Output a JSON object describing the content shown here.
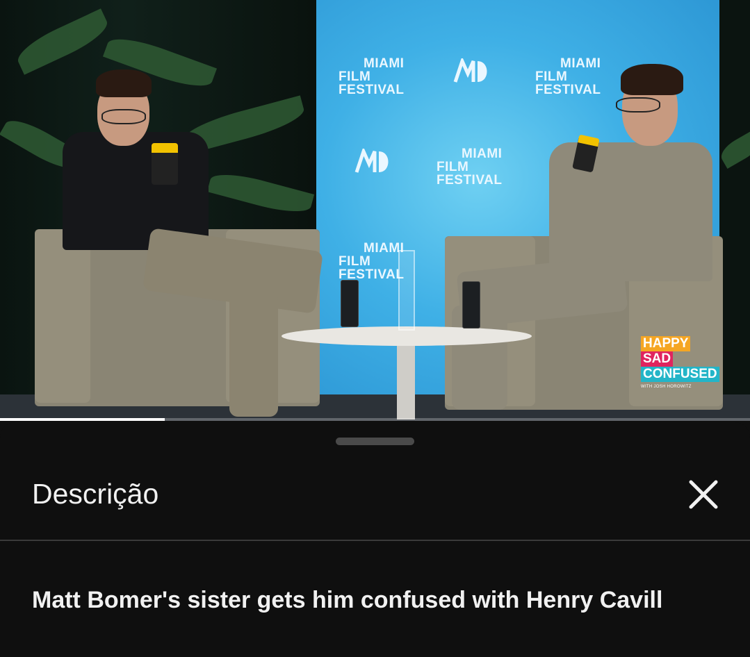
{
  "video": {
    "backdrop_logo_text": [
      "MIAMI",
      "FILM",
      "FESTIVAL"
    ],
    "badge": {
      "happy": "HAPPY",
      "sad": "SAD",
      "confused": "CONFUSED",
      "sub": "WITH JOSH HOROWITZ"
    },
    "progress_fraction": 0.22
  },
  "sheet": {
    "title": "Descrição",
    "close_icon": "close-icon",
    "video_title": "Matt Bomer's sister gets him confused with Henry Cavill"
  },
  "colors": {
    "background": "#0f0f0f",
    "text": "#f1f1f1",
    "divider": "#3a3a3a",
    "backdrop": "#3fb0e6"
  }
}
